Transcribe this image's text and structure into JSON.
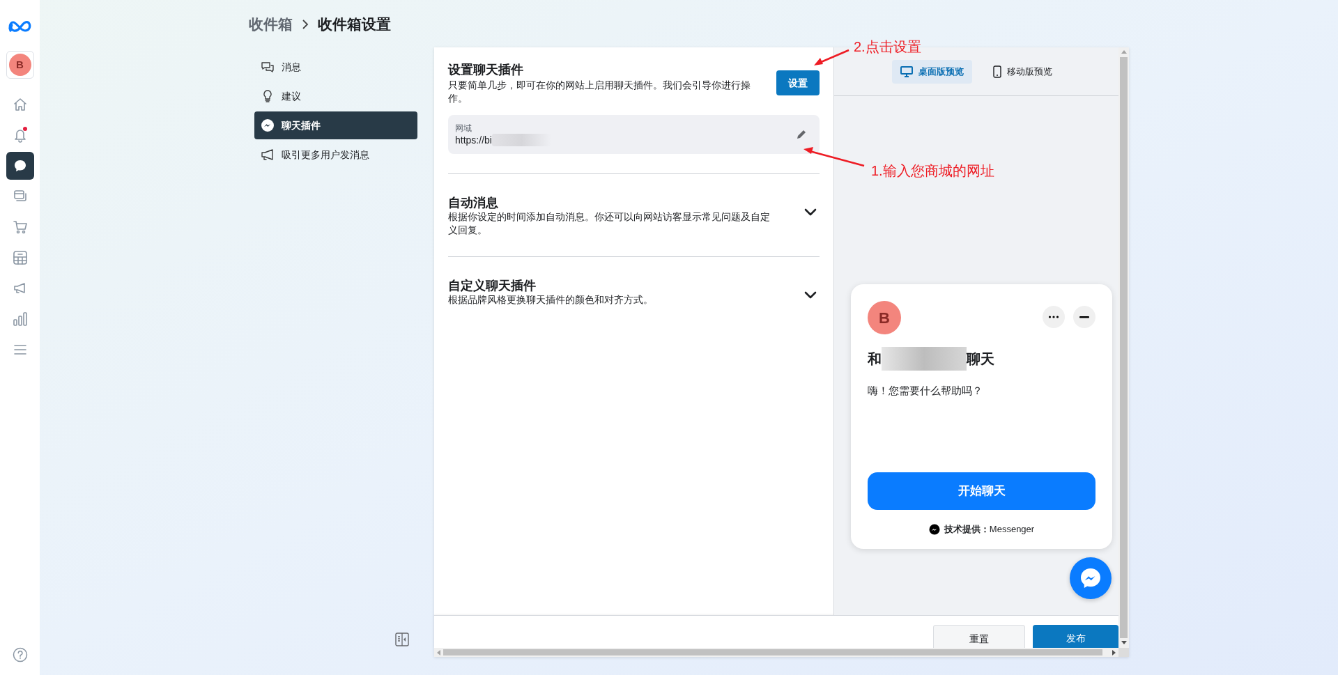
{
  "rail": {
    "items": [
      {
        "kind": "home",
        "selected": false,
        "badge": false
      },
      {
        "kind": "bell",
        "selected": false,
        "badge": true
      },
      {
        "kind": "chat",
        "selected": true,
        "badge": false
      },
      {
        "kind": "windows",
        "selected": false,
        "badge": false
      },
      {
        "kind": "cart",
        "selected": false,
        "badge": false
      },
      {
        "kind": "table",
        "selected": false,
        "badge": false
      },
      {
        "kind": "megaphone",
        "selected": false,
        "badge": false
      },
      {
        "kind": "bars",
        "selected": false,
        "badge": false
      },
      {
        "kind": "menu",
        "selected": false,
        "badge": false
      }
    ],
    "avatar": "B"
  },
  "breadcrumb": [
    "收件箱",
    "收件箱设置"
  ],
  "nav": {
    "items": [
      {
        "label": "消息",
        "kind": "chat",
        "selected": false
      },
      {
        "label": "建议",
        "kind": "bulb",
        "selected": false
      },
      {
        "label": "聊天插件",
        "kind": "messenger",
        "selected": true
      },
      {
        "label": "吸引更多用户发消息",
        "kind": "megaphone",
        "selected": false
      }
    ]
  },
  "setup": {
    "title": "设置聊天插件",
    "description": "只要简单几步，即可在你的网站上启用聊天插件。我们会引导你进行操作。",
    "button": "设置",
    "domain": {
      "label": "网域",
      "value": "https://bi"
    }
  },
  "sections": [
    {
      "title": "自动消息",
      "description": "根据你设定的时间添加自动消息。你还可以向网站访客显示常见问题及自定义回复。",
      "expanded": false
    },
    {
      "title": "自定义聊天插件",
      "description": "根据品牌风格更换聊天插件的颜色和对齐方式。",
      "expanded": false
    }
  ],
  "preview": {
    "tabs": [
      {
        "label": "桌面版预览",
        "kind": "desktop",
        "selected": true
      },
      {
        "label": "移动版预览",
        "kind": "mobile",
        "selected": false
      }
    ],
    "chat_card": {
      "avatar": "B",
      "title_prefix": "和",
      "title_suffix": "聊天",
      "greeting": "嗨！您需要什么帮助吗？",
      "button": "开始聊天",
      "footer": "**技术提供：**Messenger"
    }
  },
  "footer_buttons": [
    {
      "label": "重置",
      "kind": "secondary"
    },
    {
      "label": "发布",
      "kind": "primary"
    }
  ],
  "annotations": [
    {
      "text": "2.点击设置"
    },
    {
      "text": "1.输入您商城的网址"
    }
  ]
}
